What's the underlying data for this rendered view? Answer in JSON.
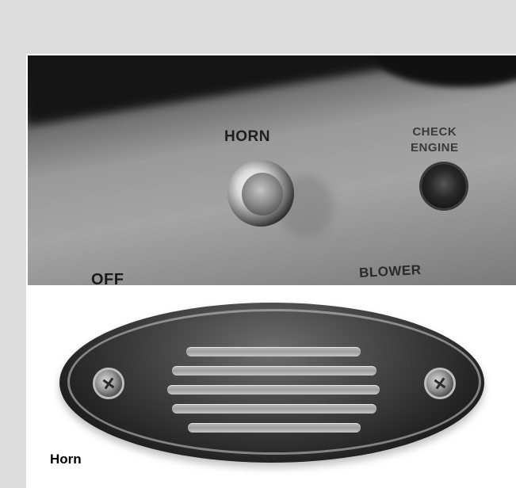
{
  "dashboard_photo": {
    "horn_label": "HORN",
    "check_engine_line1": "CHECK",
    "check_engine_line2": "ENGINE",
    "off_label": "OFF",
    "blower_label": "BLOWER"
  },
  "caption": "Horn",
  "colors": {
    "background": "#dcdcdc",
    "card": "#ffffff",
    "caption_text": "#000000"
  }
}
